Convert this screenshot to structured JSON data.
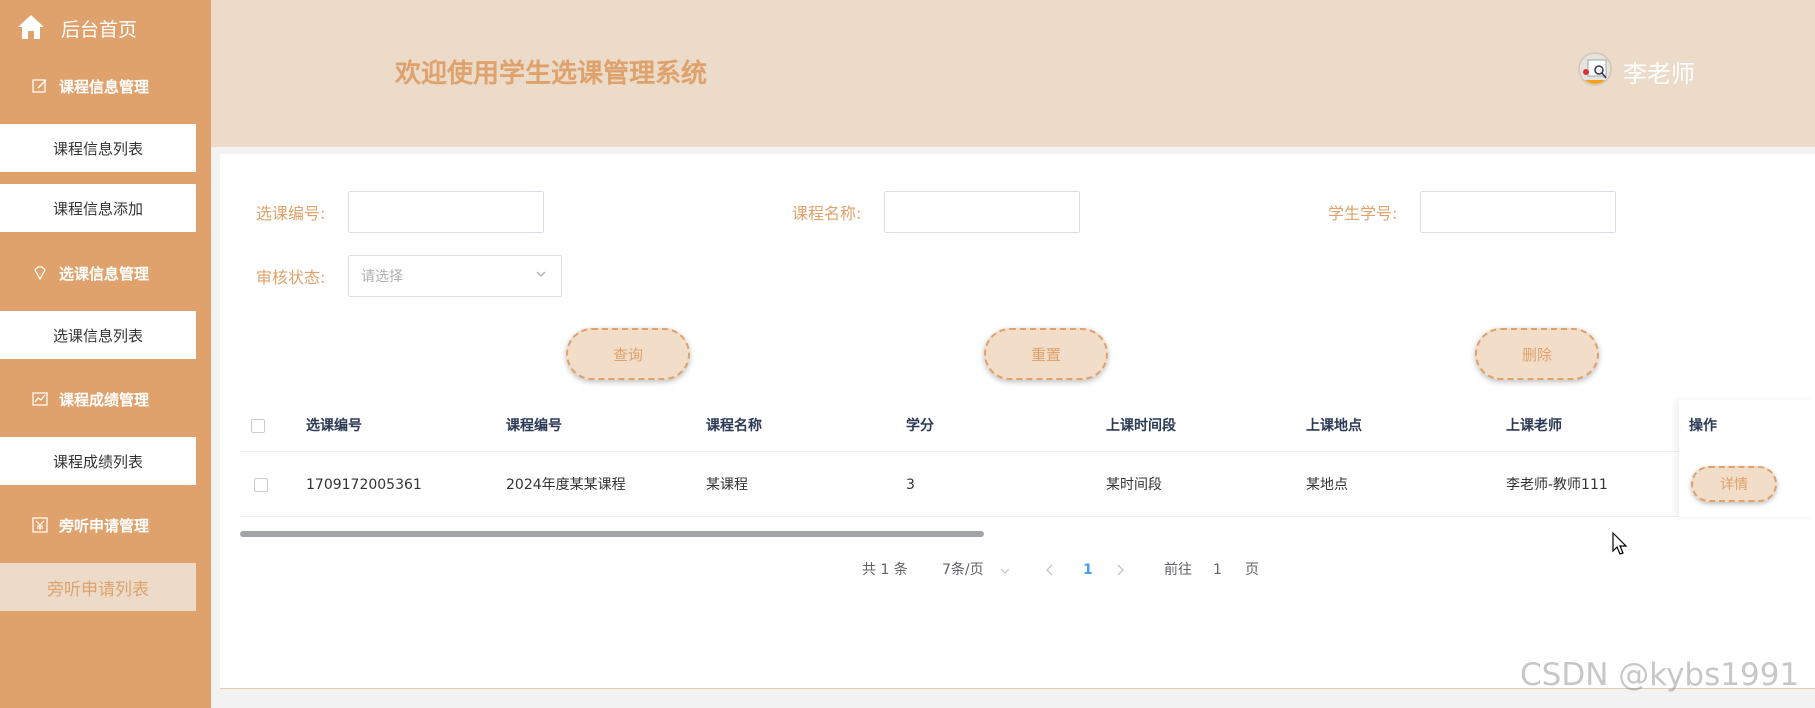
{
  "sidebar": {
    "home": "后台首页",
    "groups": [
      {
        "title": "课程信息管理",
        "icon": "edit-icon",
        "items": [
          "课程信息列表",
          "课程信息添加"
        ]
      },
      {
        "title": "选课信息管理",
        "icon": "diamond-icon",
        "items": [
          "选课信息列表"
        ]
      },
      {
        "title": "课程成绩管理",
        "icon": "chart-icon",
        "items": [
          "课程成绩列表"
        ]
      },
      {
        "title": "旁听申请管理",
        "icon": "yen-icon",
        "items": [
          "旁听申请列表"
        ]
      }
    ]
  },
  "header": {
    "title": "欢迎使用学生选课管理系统",
    "username": "李老师"
  },
  "filters": {
    "selection_id_label": "选课编号:",
    "course_name_label": "课程名称:",
    "student_id_label": "学生学号:",
    "review_status_label": "审核状态:",
    "review_status_placeholder": "请选择"
  },
  "buttons": {
    "search": "查询",
    "reset": "重置",
    "delete": "删除"
  },
  "table": {
    "columns": [
      "选课编号",
      "课程编号",
      "课程名称",
      "学分",
      "上课时间段",
      "上课地点",
      "上课老师",
      "操作"
    ],
    "rows": [
      {
        "selection_id": "1709172005361",
        "course_id": "2024年度某某课程",
        "course_name": "某课程",
        "credit": "3",
        "time": "某时间段",
        "location": "某地点",
        "teacher": "李老师-教师111",
        "action": "详情"
      }
    ]
  },
  "pagination": {
    "total": "共 1 条",
    "page_size": "7条/页",
    "current_page": "1",
    "goto_prefix": "前往",
    "goto_value": "1",
    "goto_suffix": "页"
  },
  "watermark": "CSDN @kybs1991",
  "colors": {
    "accent": "#dfa26c",
    "header_bg": "#ebdbc8",
    "active_link": "#409eff"
  }
}
